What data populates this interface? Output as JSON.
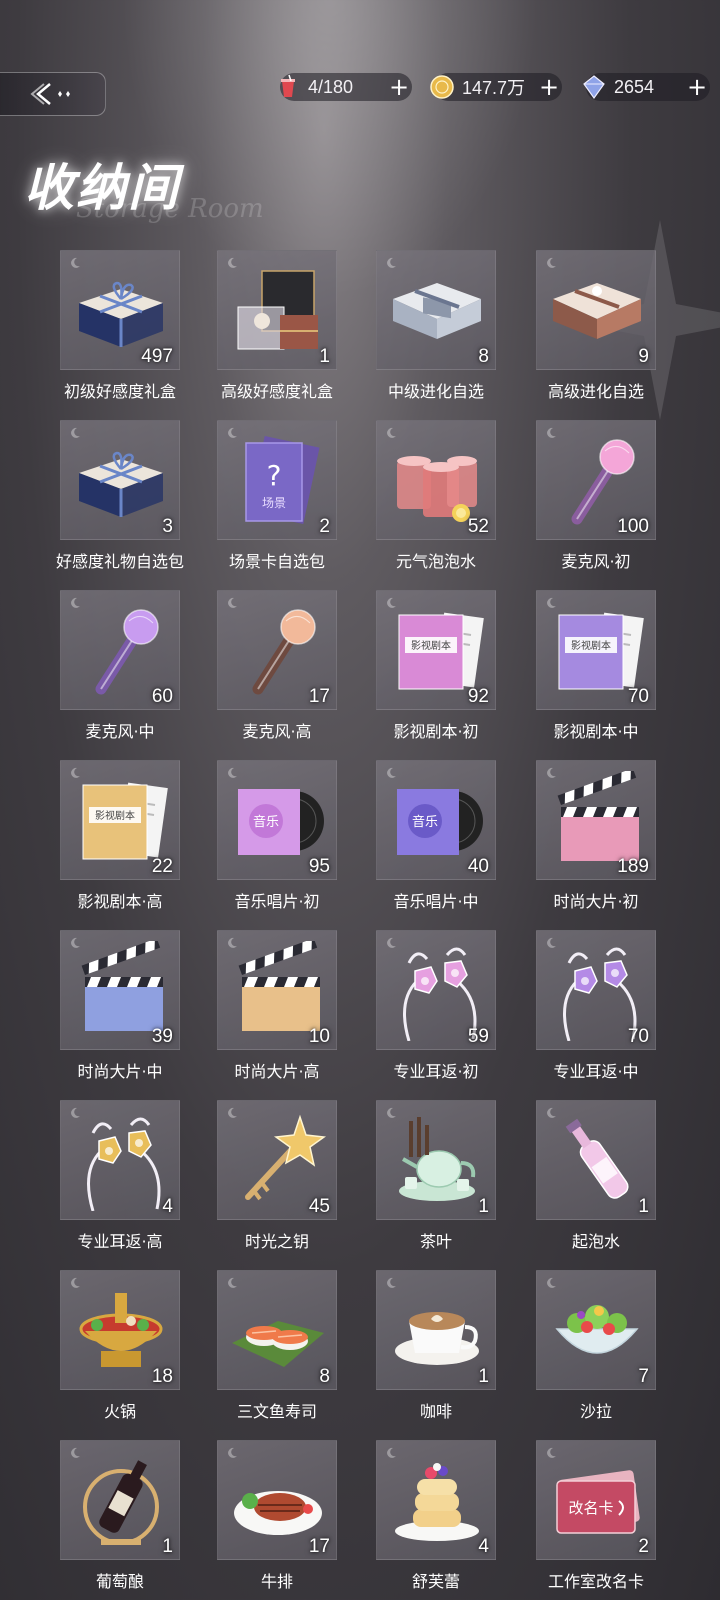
{
  "header": {
    "title": "收纳间",
    "subtitle": "Storage Room",
    "back_icon": "back-arrow-icon"
  },
  "currencies": [
    {
      "name": "stamina",
      "icon": "drink-cup-icon",
      "value": "4/180",
      "color": "#e0484f"
    },
    {
      "name": "gold",
      "icon": "gold-coin-icon",
      "value": "147.7万",
      "color": "#e8b94a"
    },
    {
      "name": "diamond",
      "icon": "diamond-icon",
      "value": "2654",
      "color": "#8fa3e8"
    }
  ],
  "items": [
    {
      "label": "初级好感度礼盒",
      "count": "497",
      "icon": "navy-gift-box-icon"
    },
    {
      "label": "高级好感度礼盒",
      "count": "1",
      "icon": "premium-gift-box-icon"
    },
    {
      "label": "中级进化自选",
      "count": "8",
      "icon": "silver-box-icon"
    },
    {
      "label": "高级进化自选",
      "count": "9",
      "icon": "rose-gold-box-icon"
    },
    {
      "label": "好感度礼物自选包",
      "count": "3",
      "icon": "navy-gift-box-icon"
    },
    {
      "label": "场景卡自选包",
      "count": "2",
      "icon": "scene-card-icon"
    },
    {
      "label": "元气泡泡水",
      "count": "52",
      "icon": "bubble-drink-icon"
    },
    {
      "label": "麦克风·初",
      "count": "100",
      "icon": "pink-microphone-icon"
    },
    {
      "label": "麦克风·中",
      "count": "60",
      "icon": "purple-microphone-icon"
    },
    {
      "label": "麦克风·高",
      "count": "17",
      "icon": "gold-microphone-icon"
    },
    {
      "label": "影视剧本·初",
      "count": "92",
      "icon": "pink-script-icon"
    },
    {
      "label": "影视剧本·中",
      "count": "70",
      "icon": "purple-script-icon"
    },
    {
      "label": "影视剧本·高",
      "count": "22",
      "icon": "gold-script-icon"
    },
    {
      "label": "音乐唱片·初",
      "count": "95",
      "icon": "pink-record-icon"
    },
    {
      "label": "音乐唱片·中",
      "count": "40",
      "icon": "purple-record-icon"
    },
    {
      "label": "时尚大片·初",
      "count": "189",
      "icon": "pink-clapperboard-icon"
    },
    {
      "label": "时尚大片·中",
      "count": "39",
      "icon": "blue-clapperboard-icon"
    },
    {
      "label": "时尚大片·高",
      "count": "10",
      "icon": "gold-clapperboard-icon"
    },
    {
      "label": "专业耳返·初",
      "count": "59",
      "icon": "pink-earphone-icon"
    },
    {
      "label": "专业耳返·中",
      "count": "70",
      "icon": "purple-earphone-icon"
    },
    {
      "label": "专业耳返·高",
      "count": "4",
      "icon": "gold-earphone-icon"
    },
    {
      "label": "时光之钥",
      "count": "45",
      "icon": "star-key-icon"
    },
    {
      "label": "茶叶",
      "count": "1",
      "icon": "teapot-icon"
    },
    {
      "label": "起泡水",
      "count": "1",
      "icon": "sparkling-bottle-icon"
    },
    {
      "label": "火锅",
      "count": "18",
      "icon": "hotpot-icon"
    },
    {
      "label": "三文鱼寿司",
      "count": "8",
      "icon": "salmon-sushi-icon"
    },
    {
      "label": "咖啡",
      "count": "1",
      "icon": "coffee-cup-icon"
    },
    {
      "label": "沙拉",
      "count": "7",
      "icon": "salad-bowl-icon"
    },
    {
      "label": "葡萄酿",
      "count": "1",
      "icon": "wine-bottle-icon"
    },
    {
      "label": "牛排",
      "count": "17",
      "icon": "steak-plate-icon"
    },
    {
      "label": "舒芙蕾",
      "count": "4",
      "icon": "souffle-pancake-icon"
    },
    {
      "label": "工作室改名卡",
      "count": "2",
      "icon": "rename-card-icon"
    }
  ],
  "item_tile_text": {
    "script": "影视剧本",
    "record": "音乐",
    "scene": "场景",
    "rename": "改名卡"
  }
}
